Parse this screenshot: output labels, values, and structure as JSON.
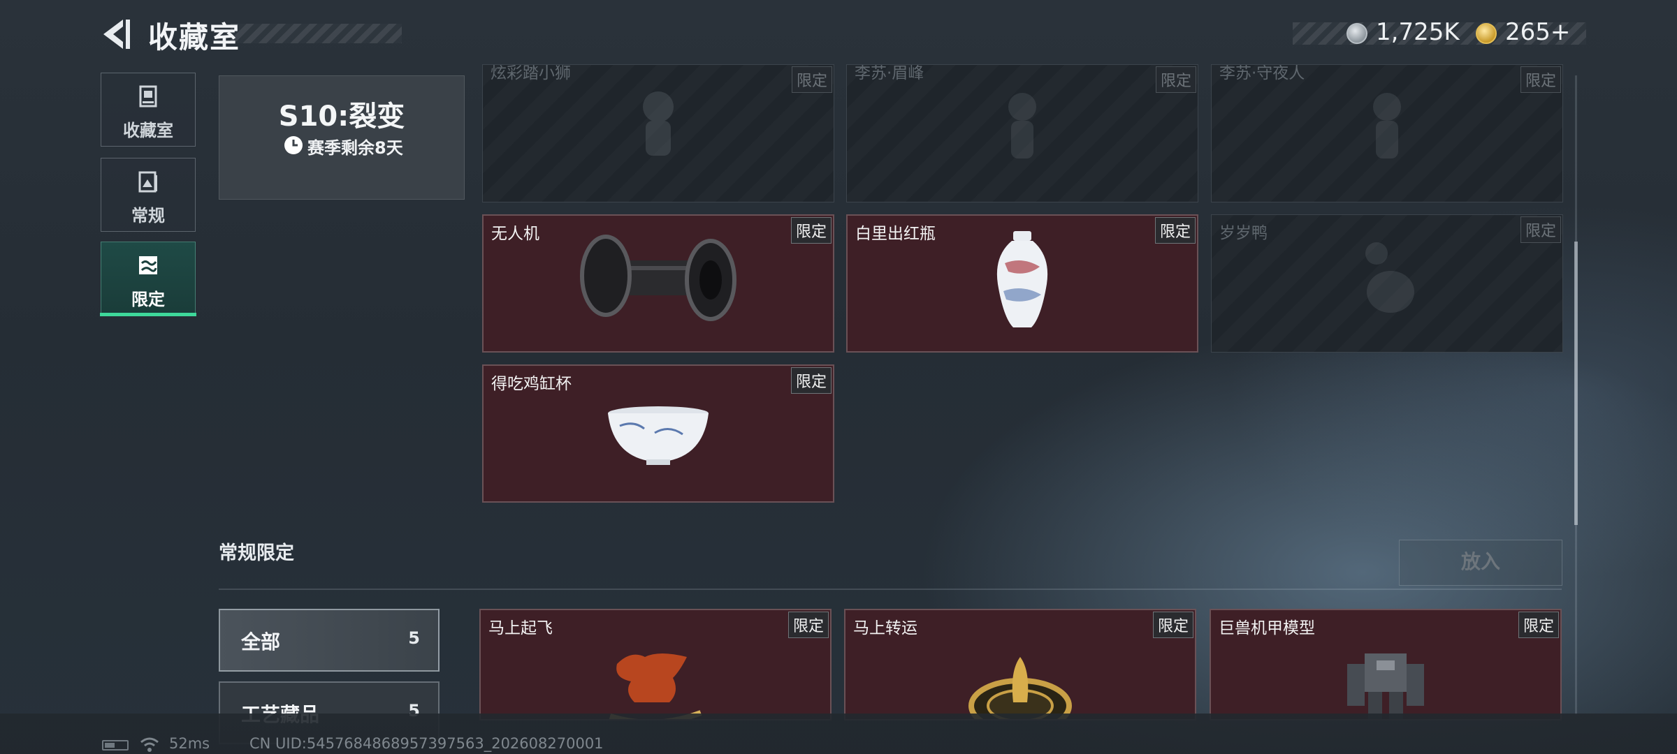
{
  "header": {
    "title": "收藏室",
    "back_icon": "chevron-left-icon",
    "currencies": [
      {
        "icon": "silver-coin-icon",
        "value": "1,725K"
      },
      {
        "icon": "gold-coin-icon",
        "value": "265+"
      }
    ]
  },
  "sidebar": {
    "items": [
      {
        "label": "收藏室",
        "icon": "display-case-icon",
        "selected": false
      },
      {
        "label": "常规",
        "icon": "collection-book-icon",
        "selected": false
      },
      {
        "label": "限定",
        "icon": "limited-image-icon",
        "selected": true
      }
    ]
  },
  "season": {
    "title": "S10:裂变",
    "remaining": "赛季剩余8天",
    "clock_icon": "clock-icon"
  },
  "season_items": [
    {
      "name": "炫彩踏小狮",
      "badge": "限定",
      "owned": false
    },
    {
      "name": "李苏·眉峰",
      "badge": "限定",
      "owned": false
    },
    {
      "name": "李苏·守夜人",
      "badge": "限定",
      "owned": false
    },
    {
      "name": "无人机",
      "badge": "限定",
      "owned": true,
      "art": "drone-roller"
    },
    {
      "name": "白里出红瓶",
      "badge": "限定",
      "owned": true,
      "art": "porcelain-vase"
    },
    {
      "name": "岁岁鸭",
      "badge": "限定",
      "owned": false
    },
    {
      "name": "得吃鸡缸杯",
      "badge": "限定",
      "owned": true,
      "art": "porcelain-cup"
    }
  ],
  "regular_limited": {
    "title": "常规限定",
    "put_button": "放入",
    "filters": [
      {
        "label": "全部",
        "count": "5",
        "selected": true
      },
      {
        "label": "工艺藏品",
        "count": "5",
        "selected": false
      }
    ],
    "items": [
      {
        "name": "马上起飞",
        "badge": "限定",
        "owned": true,
        "art": "rocking-horse"
      },
      {
        "name": "马上转运",
        "badge": "限定",
        "owned": true,
        "art": "golden-compass"
      },
      {
        "name": "巨兽机甲模型",
        "badge": "限定",
        "owned": true,
        "art": "mech-model"
      }
    ]
  },
  "status_bar": {
    "ping": "52ms",
    "uid": "CN UID:5457684868957397563_202608270001",
    "battery_icon": "battery-icon",
    "wifi_icon": "wifi-icon"
  },
  "colors": {
    "owned_card": "#3e1f26",
    "selected_tab": "#3ed89a",
    "background": "#252d35"
  }
}
